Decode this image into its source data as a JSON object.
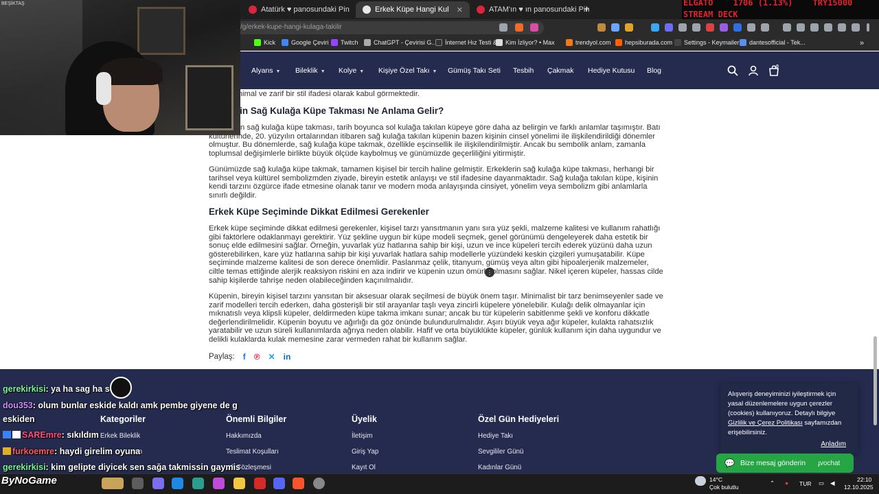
{
  "browser": {
    "tabs": [
      {
        "title": "Atatürk ♥ panosundaki Pin",
        "active": false
      },
      {
        "title": "Erkek Küpe Hangi Kulağa Takılır?",
        "active": true
      },
      {
        "title": "ATAM'ın ♥ ın panosundaki Pin",
        "active": false
      }
    ],
    "new_tab": "+",
    "url": "/g/erkek-kupe-hangi-kulaga-takilir",
    "bookmarks": [
      "Kick",
      "Google Çeviri",
      "Twitch",
      "ChatGPT - Çevirisi G...",
      "İnternet Hız Testi &...",
      "Kim İzliyor? • Max",
      "trendyol.com",
      "hepsiburada.com",
      "Settings - Keymailer",
      "dantesofficial - Tek..."
    ],
    "bookmarks_more": "»"
  },
  "stock_ticker": {
    "line1": [
      "ELGATO",
      "1706 (1.13%)",
      "TRY15000"
    ],
    "line2": "STREAM DECK"
  },
  "site_nav": {
    "items": [
      {
        "label": "Alyans",
        "dropdown": true
      },
      {
        "label": "Bileklik",
        "dropdown": true
      },
      {
        "label": "Kolye",
        "dropdown": true
      },
      {
        "label": "Kişiye Özel Takı",
        "dropdown": true
      },
      {
        "label": "Gümüş Takı Seti",
        "dropdown": false
      },
      {
        "label": "Tesbih",
        "dropdown": false
      },
      {
        "label": "Çakmak",
        "dropdown": false
      },
      {
        "label": "Hediye Kutusu",
        "dropdown": false
      },
      {
        "label": "Blog",
        "dropdown": false
      }
    ],
    "cart_count": "0"
  },
  "article": {
    "top_fragment": "küpe, minimal ve zarif bir stil ifadesi olarak kabul görmektedir.",
    "heading1": "rin Sağ Kulağa Küpe Takması Ne Anlama Gelir?",
    "p1": "n sağ kulağa küpe takması, tarih boyunca sol kulağa takılan küpeye göre daha az belirgin ve farklı anlamlar taşımıştır. Batı kültürlerinde, 20. yüzyılın ortalarından itibaren sağ kulağa takılan küpenin bazen kişinin cinsel yönelimi ile ilişkilendirildiği dönemler olmuştur. Bu dönemlerde, sağ kulağa küpe takmak, özellikle eşcinsellik ile ilişkilendirilmiştir. Ancak bu sembolik anlam, zamanla toplumsal değişimlerle birlikte büyük ölçüde kaybolmuş ve günümüzde geçerliliğini yitirmiştir.",
    "p2": "Günümüzde sağ kulağa küpe takmak, tamamen kişisel bir tercih haline gelmiştir. Erkeklerin sağ kulağa küpe takması, herhangi bir tarihsel veya kültürel sembolizmden ziyade, bireyin estetik anlayışı ve stil ifadesine dayanmaktadır. Sağ kulağa takılan küpe, kişinin kendi tarzını özgürce ifade etmesine olanak tanır ve modern moda anlayışında cinsiyet, yönelim veya sembolizm gibi anlamlarla sınırlı değildir.",
    "heading2": "Erkek Küpe Seçiminde Dikkat Edilmesi Gerekenler",
    "p3": "Erkek küpe seçiminde dikkat edilmesi gerekenler, kişisel tarzı yansıtmanın yanı sıra yüz şekli, malzeme kalitesi ve kullanım rahatlığı gibi faktörlere odaklanmayı gerektirir. Yüz şekline uygun bir küpe modeli seçmek, genel görünümü dengeleyerek daha estetik bir sonuç elde edilmesini sağlar. Örneğin, yuvarlak yüz hatlarına sahip bir kişi, uzun ve ince küpeleri tercih ederek yüzünü daha uzun gösterebilirken, kare yüz hatlarına sahip bir kişi yuvarlak hatlara sahip modellerle yüzündeki keskin çizgileri yumuşatabilir. Küpe seçiminde malzeme kalitesi de son derece önemlidir. Paslanmaz çelik, titanyum, gümüş veya altın gibi hipoalerjenik malzemeler, ciltle temas ettiğinde alerjik reaksiyon riskini en aza indirir ve küpenin uzun ömürlü olmasını sağlar. Nikel içeren küpeler, hassas cilde sahip kişilerde tahrişe neden olabileceğinden kaçınılmalıdır.",
    "p4": "Küpenin, bireyin kişisel tarzını yansıtan bir aksesuar olarak seçilmesi de büyük önem taşır. Minimalist bir tarz benimseyenler sade ve zarif modelleri tercih ederken, daha gösterişli bir stil arayanlar taşlı veya zincirli küpelere yönelebilir. Kulağı delik olmayanlar için mıknatıslı veya klipsli küpeler, deldirmeden küpe takma imkanı sunar; ancak bu tür küpelerin sabitlenme şekli ve konforu dikkatle değerlendirilmelidir. Küpenin boyutu ve ağırlığı da göz önünde bulundurulmalıdır. Aşırı büyük veya ağır küpeler, kulakta rahatsızlık yaratabilir ve uzun süreli kullanımlarda ağrıya neden olabilir. Hafif ve orta büyüklükte küpeler, günlük kullanım için daha uygundur ve delikli kulaklarda kulak memesine zarar vermeden rahat bir kullanım sağlar.",
    "share_label": "Paylaş:",
    "share_icons": [
      "facebook-icon",
      "pinterest-icon",
      "x-icon",
      "linkedin-icon"
    ]
  },
  "footer": {
    "columns": [
      {
        "title": "Kategoriler",
        "links": [
          "Erkek Bileklik",
          "...on",
          "..."
        ]
      },
      {
        "title": "Önemli Bilgiler",
        "links": [
          "Hakkımızda",
          "Teslimat Koşulları",
          "...k Sözleşmesi"
        ]
      },
      {
        "title": "Üyelik",
        "links": [
          "İletişim",
          "Giriş Yap",
          "Kayıt Ol"
        ]
      },
      {
        "title": "Özel Gün Hediyeleri",
        "links": [
          "Hediye Takı",
          "Sevgililer Günü",
          "Kadınlar Günü"
        ]
      }
    ]
  },
  "cookie": {
    "text1": "Alışveriş deneyiminizi iyileştirmek için yasal düzenlemelere uygun çerezler (cookies) kullanıyoruz. Detaylı bilgiye ",
    "link": "Gizlilik ve Çerez Politikası",
    "text2": " sayfamızdan erişebilirsiniz.",
    "accept": "Anladım"
  },
  "whatsapp": {
    "label": "Bize mesaj gönderin",
    "badge": "ɟvochat"
  },
  "chat": [
    {
      "user": "gerekirkisi",
      "msg": ": ya ha sag ha sol",
      "color": "u1",
      "badge": ""
    },
    {
      "user": "dou353",
      "msg": ": olum bunlar eskide kaldı amk pembe giyene de g",
      "color": "u2",
      "badge": ""
    },
    {
      "user": "",
      "msg": "eskiden",
      "color": "",
      "badge": ""
    },
    {
      "user": "SAREmre",
      "msg": ": sıkıldım",
      "color": "u3",
      "badge": "blue"
    },
    {
      "user": "furkoemre",
      "msg": ": haydi girelim oyuna",
      "color": "u4",
      "badge": "gold"
    },
    {
      "user": "gerekirkisi",
      "msg": ": kim gelipte diyicek sen sağa takmissin gaymis",
      "color": "u1",
      "badge": ""
    }
  ],
  "cam": {
    "tag": "BEŞİKTAŞ"
  },
  "watermark": "ByNoGame",
  "taskbar": {
    "weather_temp": "14°C",
    "weather_desc": "Çok bulutlu",
    "lang": "TUR",
    "time": "22:10",
    "date": "12.10.2025"
  }
}
